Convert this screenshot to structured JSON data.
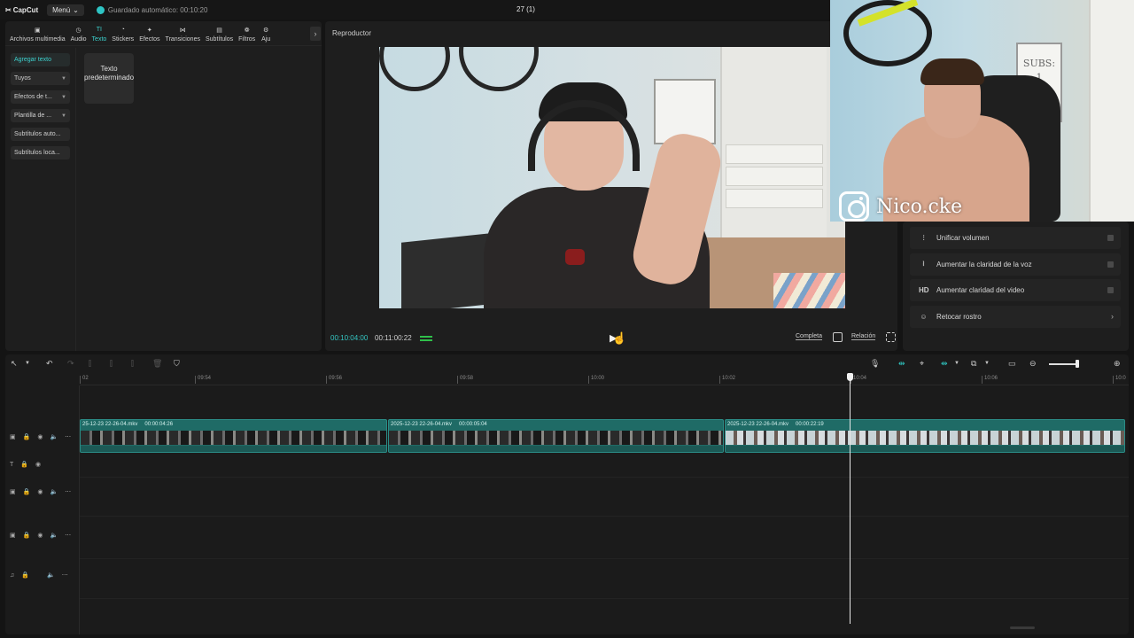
{
  "app": {
    "logo": "CapCut",
    "menu_label": "Menú",
    "autosave": "Guardado automático: 00:10:20",
    "project_title": "27 (1)"
  },
  "media_tabs": [
    {
      "label": "Archivos multimedia",
      "icon": "media-icon"
    },
    {
      "label": "Audio",
      "icon": "audio-icon"
    },
    {
      "label": "Texto",
      "icon": "text-icon",
      "active": true
    },
    {
      "label": "Stickers",
      "icon": "sticker-icon"
    },
    {
      "label": "Efectos",
      "icon": "effects-icon"
    },
    {
      "label": "Transiciones",
      "icon": "transitions-icon"
    },
    {
      "label": "Subtítulos",
      "icon": "captions-icon"
    },
    {
      "label": "Filtros",
      "icon": "filters-icon"
    },
    {
      "label": "Aju",
      "icon": "adjust-icon"
    }
  ],
  "text_nav": [
    {
      "label": "Agregar texto",
      "active": true
    },
    {
      "label": "Tuyos",
      "caret": true
    },
    {
      "label": "Efectos de t...",
      "caret": true
    },
    {
      "label": "Plantilla de ...",
      "caret": true
    },
    {
      "label": "Subtítulos auto..."
    },
    {
      "label": "Subtítulos loca..."
    }
  ],
  "text_card": "Texto predeterminado",
  "player": {
    "title": "Reproductor",
    "current_time": "00:10:04:00",
    "total_time": "00:11:00:22",
    "full_label": "Completa",
    "ratio_label": "Relación"
  },
  "right_panel": [
    {
      "label": "Unificar volumen",
      "icon": "equalizer-icon",
      "glyph": "⫶",
      "type": "toggle"
    },
    {
      "label": "Aumentar la claridad de la voz",
      "icon": "voice-wave-icon",
      "glyph": "⧘",
      "type": "toggle"
    },
    {
      "label": "Aumentar claridad del video",
      "icon": "hd-icon",
      "glyph": "HD",
      "type": "toggle"
    },
    {
      "label": "Retocar rostro",
      "icon": "face-retouch-icon",
      "glyph": "☺",
      "type": "arrow"
    }
  ],
  "webcam": {
    "handle": "Nico.cke",
    "board_text": "SUBS: 1"
  },
  "timeline": {
    "ruler": [
      "02",
      "09:54",
      "09:56",
      "09:58",
      "10:00",
      "10:02",
      "10:04",
      "10:06",
      "10:0"
    ],
    "clips": [
      {
        "name": "25-12-23 22-26-04.mkv",
        "duration": "00:00:04:26",
        "style": "dark"
      },
      {
        "name": "2025-12-23 22-26-04.mkv",
        "duration": "00:00:05:04",
        "style": "dark"
      },
      {
        "name": "2025-12-23 22-26-04.mkv",
        "duration": "00:00:22:19",
        "style": "light"
      }
    ]
  },
  "colors": {
    "accent": "#3dd2cf",
    "clip": "#1f6b66",
    "background": "#141414",
    "panel": "#1e1e1e"
  }
}
